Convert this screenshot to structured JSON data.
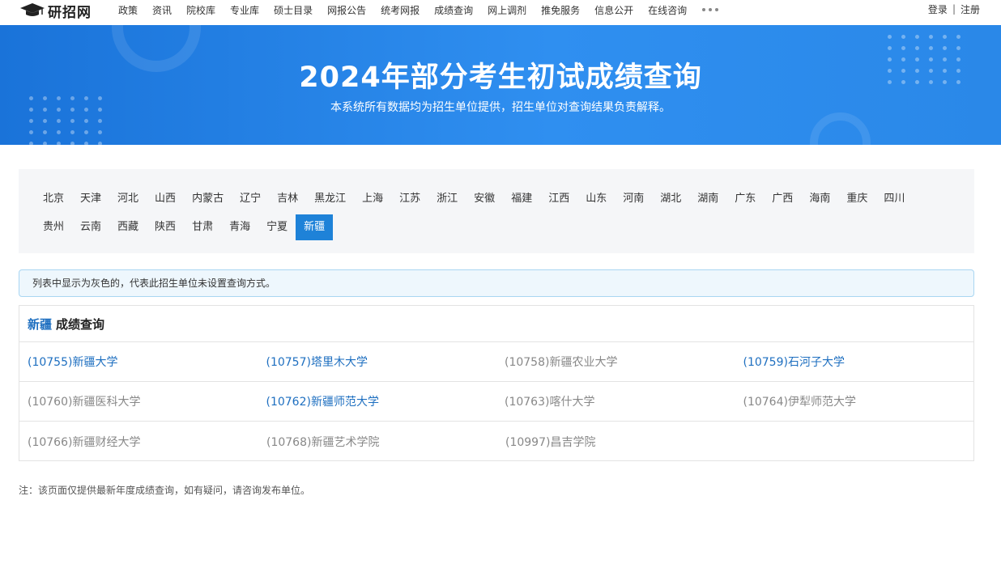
{
  "nav": {
    "logo_text": "研招网",
    "items": [
      "政策",
      "资讯",
      "院校库",
      "专业库",
      "硕士目录",
      "网报公告",
      "统考网报",
      "成绩查询",
      "网上调剂",
      "推免服务",
      "信息公开",
      "在线咨询"
    ],
    "login": "登录",
    "separator": "|",
    "register": "注册"
  },
  "banner": {
    "title": "2024年部分考生初试成绩查询",
    "subtitle": "本系统所有数据均为招生单位提供，招生单位对查询结果负责解释。"
  },
  "regions": {
    "row1": [
      "北京",
      "天津",
      "河北",
      "山西",
      "内蒙古",
      "辽宁",
      "吉林",
      "黑龙江",
      "上海",
      "江苏",
      "浙江",
      "安徽",
      "福建",
      "江西",
      "山东",
      "河南",
      "湖北",
      "湖南",
      "广东",
      "广西",
      "海南",
      "重庆",
      "四川"
    ],
    "row2": [
      "贵州",
      "云南",
      "西藏",
      "陕西",
      "甘肃",
      "青海",
      "宁夏",
      "新疆"
    ],
    "selected": "新疆"
  },
  "notice": "列表中显示为灰色的，代表此招生单位未设置查询方式。",
  "panel": {
    "province": "新疆",
    "title": "成绩查询",
    "rows": [
      [
        {
          "label": "(10755)新疆大学",
          "enabled": true
        },
        {
          "label": "(10757)塔里木大学",
          "enabled": true
        },
        {
          "label": "(10758)新疆农业大学",
          "enabled": false
        },
        {
          "label": "(10759)石河子大学",
          "enabled": true
        }
      ],
      [
        {
          "label": "(10760)新疆医科大学",
          "enabled": false
        },
        {
          "label": "(10762)新疆师范大学",
          "enabled": true
        },
        {
          "label": "(10763)喀什大学",
          "enabled": false
        },
        {
          "label": "(10764)伊犁师范大学",
          "enabled": false
        }
      ],
      [
        {
          "label": "(10766)新疆财经大学",
          "enabled": false
        },
        {
          "label": "(10768)新疆艺术学院",
          "enabled": false
        },
        {
          "label": "(10997)昌吉学院",
          "enabled": false
        }
      ]
    ]
  },
  "footnote": "注：该页面仅提供最新年度成绩查询，如有疑问，请咨询发布单位。",
  "colors": {
    "accent": "#1e82d8",
    "link": "#1e6fc0",
    "disabled": "#888888",
    "banner": "#2a88e8"
  }
}
